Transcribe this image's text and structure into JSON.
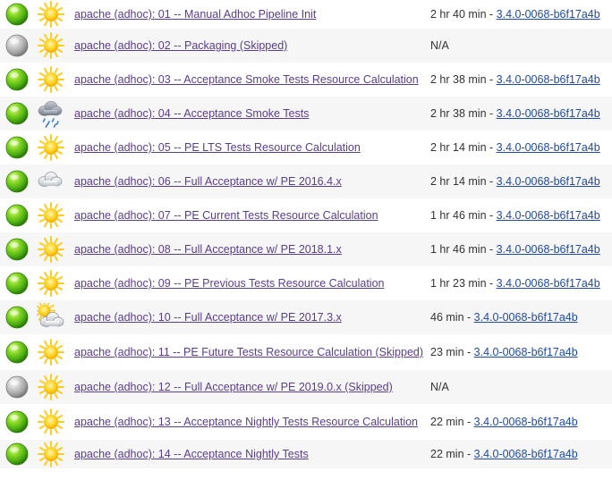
{
  "rows": [
    {
      "status": "success",
      "weather": "sunny",
      "name": "apache (adhoc): 01 -- Manual Adhoc Pipeline Init",
      "duration": "2 hr 40 min",
      "sep": " - ",
      "version": "3.4.0-0068-b6f17a4b"
    },
    {
      "status": "disabled",
      "weather": "sunny",
      "name": "apache (adhoc): 02 -- Packaging (Skipped)",
      "duration": "N/A",
      "sep": "",
      "version": ""
    },
    {
      "status": "success",
      "weather": "sunny",
      "name": "apache (adhoc): 03 -- Acceptance Smoke Tests Resource Calculation",
      "duration": "2 hr 38 min",
      "sep": " - ",
      "version": "3.4.0-0068-b6f17a4b"
    },
    {
      "status": "success",
      "weather": "rainy",
      "name": "apache (adhoc): 04 -- Acceptance Smoke Tests",
      "duration": "2 hr 38 min",
      "sep": " - ",
      "version": "3.4.0-0068-b6f17a4b"
    },
    {
      "status": "success",
      "weather": "sunny",
      "name": "apache (adhoc): 05 -- PE LTS Tests Resource Calculation",
      "duration": "2 hr 14 min",
      "sep": " - ",
      "version": "3.4.0-0068-b6f17a4b"
    },
    {
      "status": "success",
      "weather": "cloudy",
      "name": "apache (adhoc): 06 -- Full Acceptance w/ PE 2016.4.x",
      "duration": "2 hr 14 min",
      "sep": " - ",
      "version": "3.4.0-0068-b6f17a4b"
    },
    {
      "status": "success",
      "weather": "sunny",
      "name": "apache (adhoc): 07 -- PE Current Tests Resource Calculation",
      "duration": "1 hr 46 min",
      "sep": " - ",
      "version": "3.4.0-0068-b6f17a4b"
    },
    {
      "status": "success",
      "weather": "sunny",
      "name": "apache (adhoc): 08 -- Full Acceptance w/ PE 2018.1.x",
      "duration": "1 hr 46 min",
      "sep": " - ",
      "version": "3.4.0-0068-b6f17a4b"
    },
    {
      "status": "success",
      "weather": "sunny",
      "name": "apache (adhoc): 09 -- PE Previous Tests Resource Calculation",
      "duration": "1 hr 23 min",
      "sep": " - ",
      "version": "3.4.0-0068-b6f17a4b"
    },
    {
      "status": "success",
      "weather": "partly-cloudy",
      "name": "apache (adhoc): 10 -- Full Acceptance w/ PE 2017.3.x",
      "duration": "46 min",
      "sep": " - ",
      "version": "3.4.0-0068-b6f17a4b"
    },
    {
      "status": "success",
      "weather": "sunny",
      "name": "apache (adhoc): 11 -- PE Future Tests Resource Calculation (Skipped)",
      "duration": "23 min",
      "sep": " - ",
      "version": "3.4.0-0068-b6f17a4b"
    },
    {
      "status": "disabled",
      "weather": "sunny",
      "name": "apache (adhoc): 12 -- Full Acceptance w/ PE 2019.0.x (Skipped)",
      "duration": "N/A",
      "sep": "",
      "version": ""
    },
    {
      "status": "success",
      "weather": "sunny",
      "name": "apache (adhoc): 13 -- Acceptance Nightly Tests Resource Calculation",
      "duration": "22 min",
      "sep": " - ",
      "version": "3.4.0-0068-b6f17a4b"
    },
    {
      "status": "success",
      "weather": "sunny",
      "name": "apache (adhoc): 14 -- Acceptance Nightly Tests",
      "duration": "22 min",
      "sep": " - ",
      "version": "3.4.0-0068-b6f17a4b"
    }
  ],
  "colors": {
    "success": "#4db012",
    "disabled": "#a8a8a8",
    "job_link": "#5a3d8c",
    "version_link": "#1f4aa8",
    "sun": "#ffd21f"
  }
}
